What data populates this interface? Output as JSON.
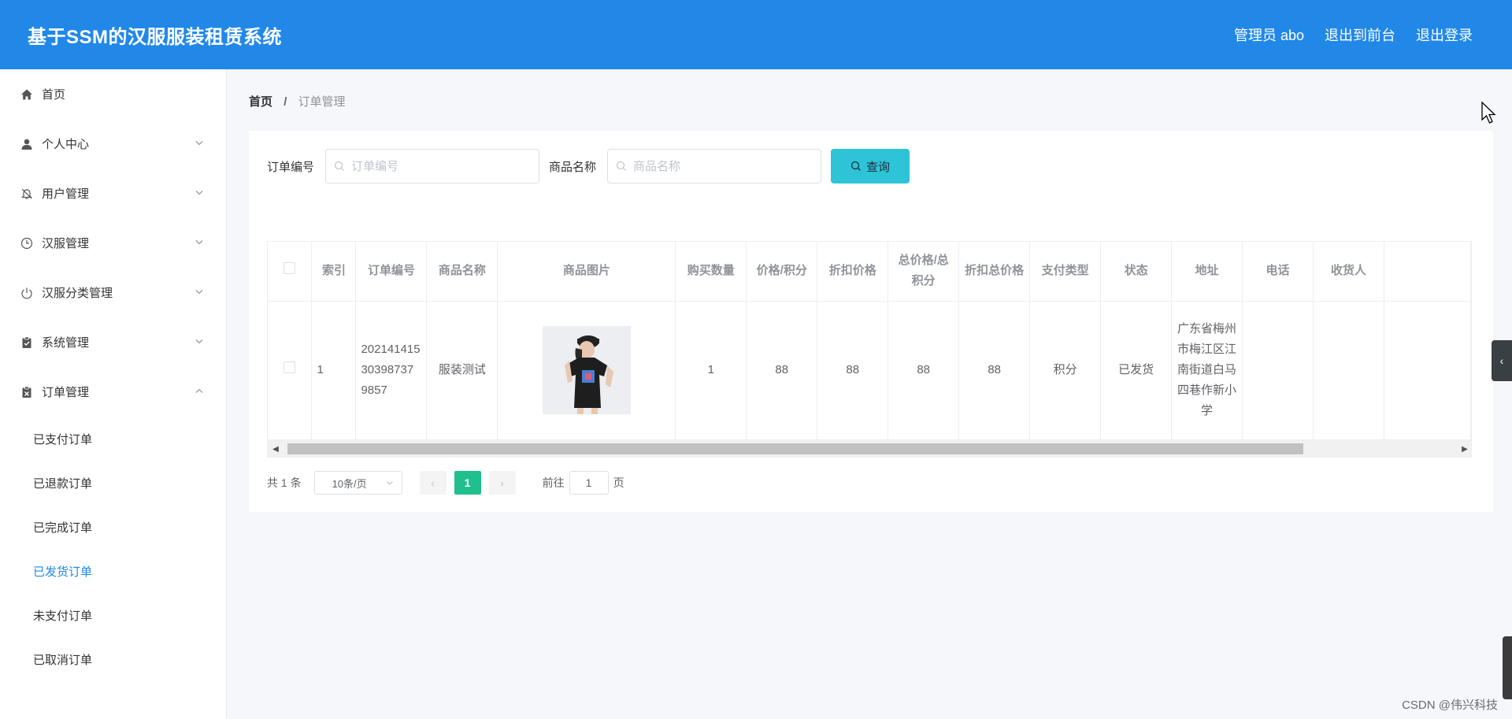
{
  "header": {
    "title": "基于SSM的汉服服装租赁系统",
    "user": "管理员 abo",
    "to_front": "退出到前台",
    "logout": "退出登录"
  },
  "sidebar": {
    "items": [
      {
        "label": "首页",
        "icon": "home-icon"
      },
      {
        "label": "个人中心",
        "icon": "user-icon"
      },
      {
        "label": "用户管理",
        "icon": "bell-off-icon"
      },
      {
        "label": "汉服管理",
        "icon": "clock-icon"
      },
      {
        "label": "汉服分类管理",
        "icon": "power-icon"
      },
      {
        "label": "系统管理",
        "icon": "clipboard-check-icon"
      },
      {
        "label": "订单管理",
        "icon": "clipboard-x-icon"
      }
    ],
    "order_sub": [
      "已支付订单",
      "已退款订单",
      "已完成订单",
      "已发货订单",
      "未支付订单",
      "已取消订单"
    ]
  },
  "breadcrumb": {
    "home": "首页",
    "sep": "/",
    "current": "订单管理"
  },
  "search": {
    "order_label": "订单编号",
    "order_placeholder": "订单编号",
    "goods_label": "商品名称",
    "goods_placeholder": "商品名称",
    "query_btn": "查询"
  },
  "table": {
    "headers": [
      "索引",
      "订单编号",
      "商品名称",
      "商品图片",
      "购买数量",
      "价格/积分",
      "折扣价格",
      "总价格/总积分",
      "折扣总价格",
      "支付类型",
      "状态",
      "地址",
      "电话",
      "收货人"
    ],
    "rows": [
      {
        "index": "1",
        "order_no": "20214141530398737 9857",
        "goods_name": "服装测试",
        "qty": "1",
        "price": "88",
        "discount_price": "88",
        "total": "88",
        "discount_total": "88",
        "pay_type": "积分",
        "status": "已发货",
        "address": "广东省梅州市梅江区江南街道白马四巷作新小学",
        "phone": "",
        "receiver": ""
      }
    ]
  },
  "pager": {
    "total": "共 1 条",
    "page_size": "10条/页",
    "current_page": "1",
    "goto_label": "前往",
    "goto_value": "1",
    "page_unit": "页"
  },
  "watermark": "CSDN @伟兴科技",
  "colors": {
    "header_bg": "#2188e8",
    "query_btn": "#2ec4d8",
    "active_page": "#1fc08e",
    "active_menu": "#2188e8"
  }
}
